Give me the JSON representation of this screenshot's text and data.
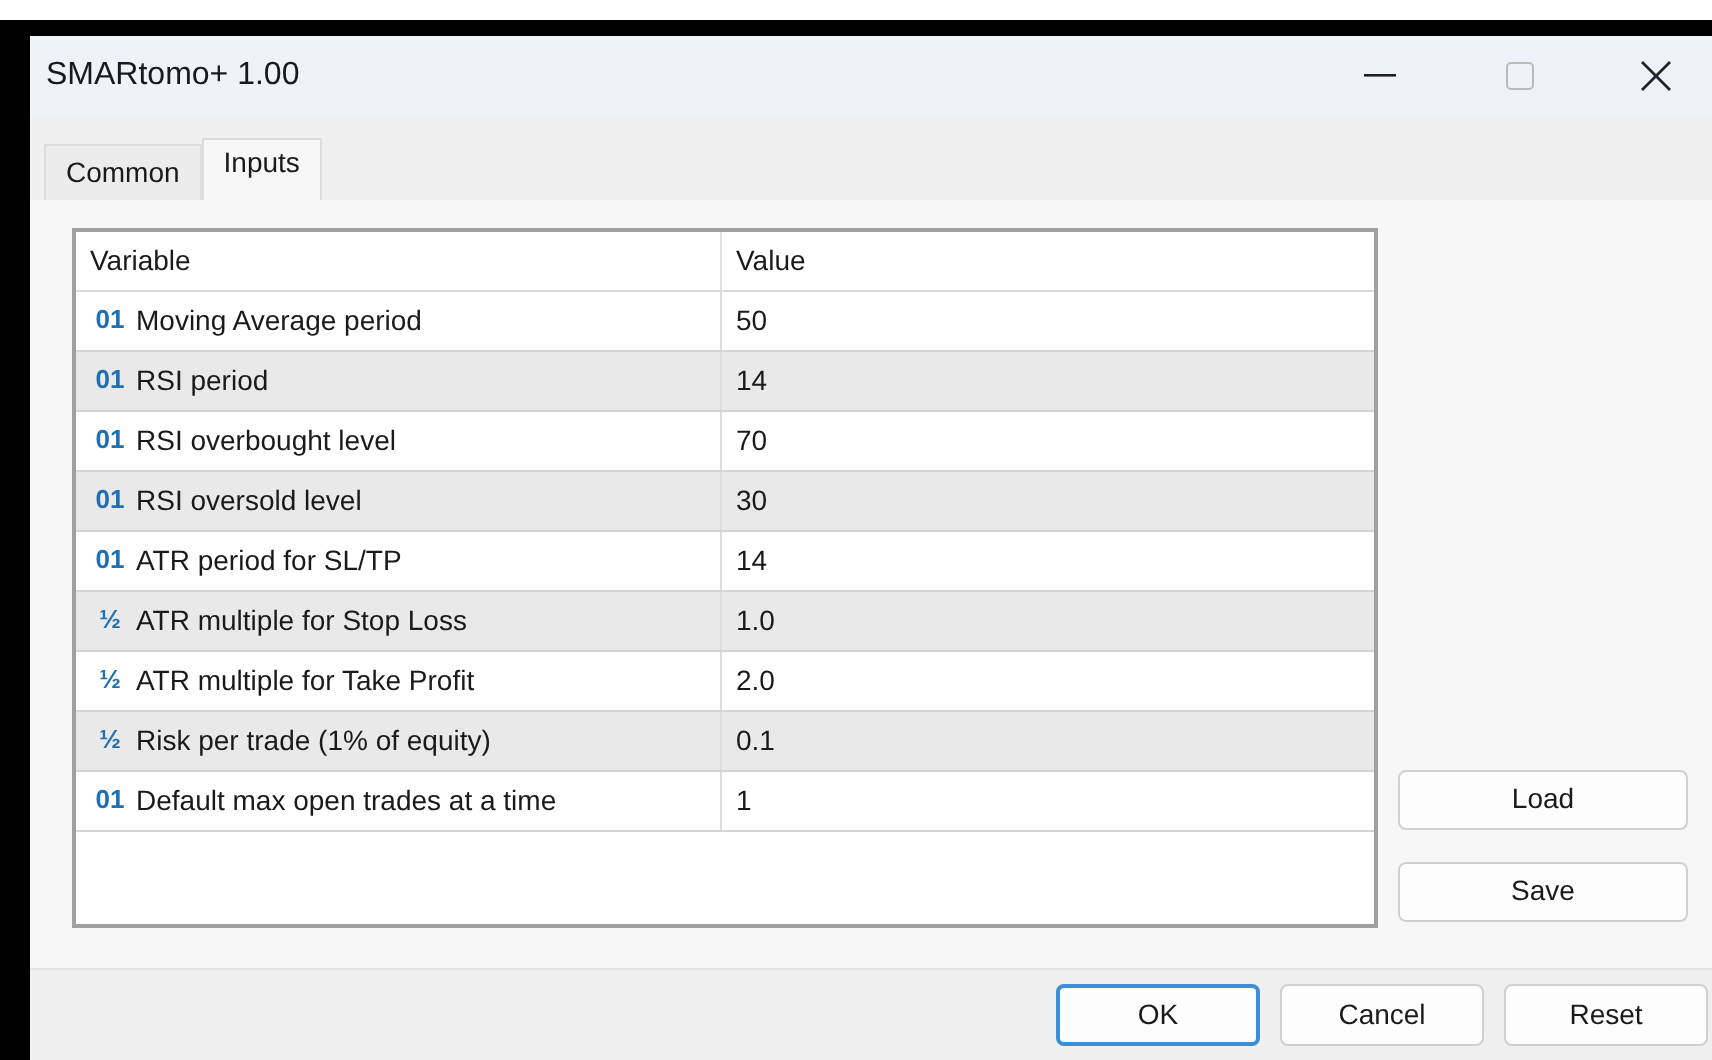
{
  "window": {
    "title": "SMARtomo+ 1.00"
  },
  "tabs": [
    {
      "label": "Common",
      "selected": false
    },
    {
      "label": "Inputs",
      "selected": true
    }
  ],
  "table": {
    "columns": [
      "Variable",
      "Value"
    ],
    "rows": [
      {
        "type_icon": "01",
        "variable": "Moving Average period",
        "value": "50"
      },
      {
        "type_icon": "01",
        "variable": "RSI period",
        "value": "14"
      },
      {
        "type_icon": "01",
        "variable": "RSI overbought level",
        "value": "70"
      },
      {
        "type_icon": "01",
        "variable": "RSI oversold level",
        "value": "30"
      },
      {
        "type_icon": "01",
        "variable": "ATR period for SL/TP",
        "value": "14"
      },
      {
        "type_icon": "½",
        "variable": "ATR multiple for Stop Loss",
        "value": "1.0"
      },
      {
        "type_icon": "½",
        "variable": "ATR multiple for Take Profit",
        "value": "2.0"
      },
      {
        "type_icon": "½",
        "variable": "Risk per trade (1% of equity)",
        "value": "0.1"
      },
      {
        "type_icon": "01",
        "variable": "Default max open trades at a time",
        "value": "1"
      }
    ]
  },
  "side_buttons": [
    "Load",
    "Save"
  ],
  "footer_buttons": [
    {
      "label": "OK",
      "default": true
    },
    {
      "label": "Cancel",
      "default": false
    },
    {
      "label": "Reset",
      "default": false
    }
  ]
}
